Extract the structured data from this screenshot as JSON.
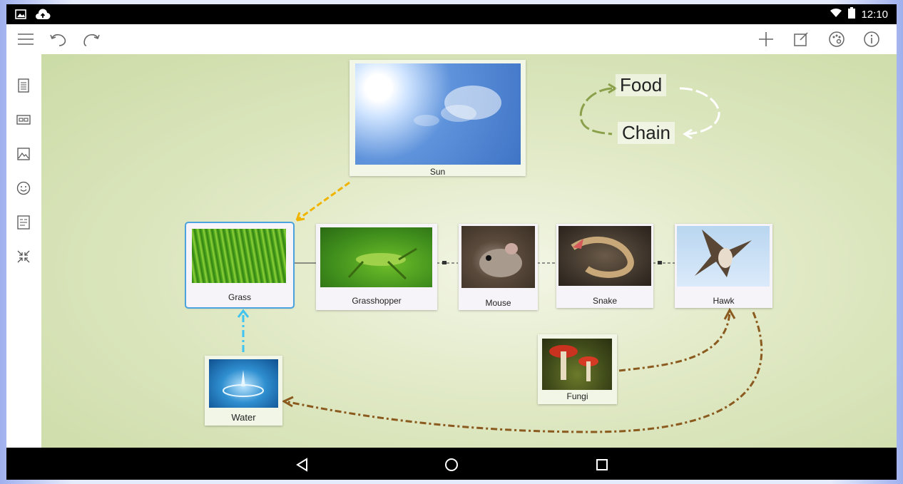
{
  "status": {
    "time": "12:10"
  },
  "toolbar": {
    "left": [
      "menu-icon",
      "undo-icon",
      "redo-icon"
    ],
    "right": [
      "add-icon",
      "edit-icon",
      "theme-icon",
      "info-icon"
    ]
  },
  "sidebar": [
    "outline-icon",
    "link-icon",
    "image-icon",
    "emoji-icon",
    "notes-icon",
    "collapse-icon"
  ],
  "title": {
    "word1": "Food",
    "word2": "Chain"
  },
  "nodes": {
    "sun": "Sun",
    "grass": "Grass",
    "grasshopper": "Grasshopper",
    "mouse": "Mouse",
    "snake": "Snake",
    "hawk": "Hawk",
    "water": "Water",
    "fungi": "Fungi"
  },
  "colors": {
    "sun_arrow": "#f0b400",
    "water_arrow": "#3fc3f0",
    "decomposer_arrow": "#8a5a1e",
    "title_arrows": "#8aa04a",
    "selection": "#4aa3df"
  },
  "navbar": [
    "back-icon",
    "home-icon",
    "recents-icon"
  ]
}
